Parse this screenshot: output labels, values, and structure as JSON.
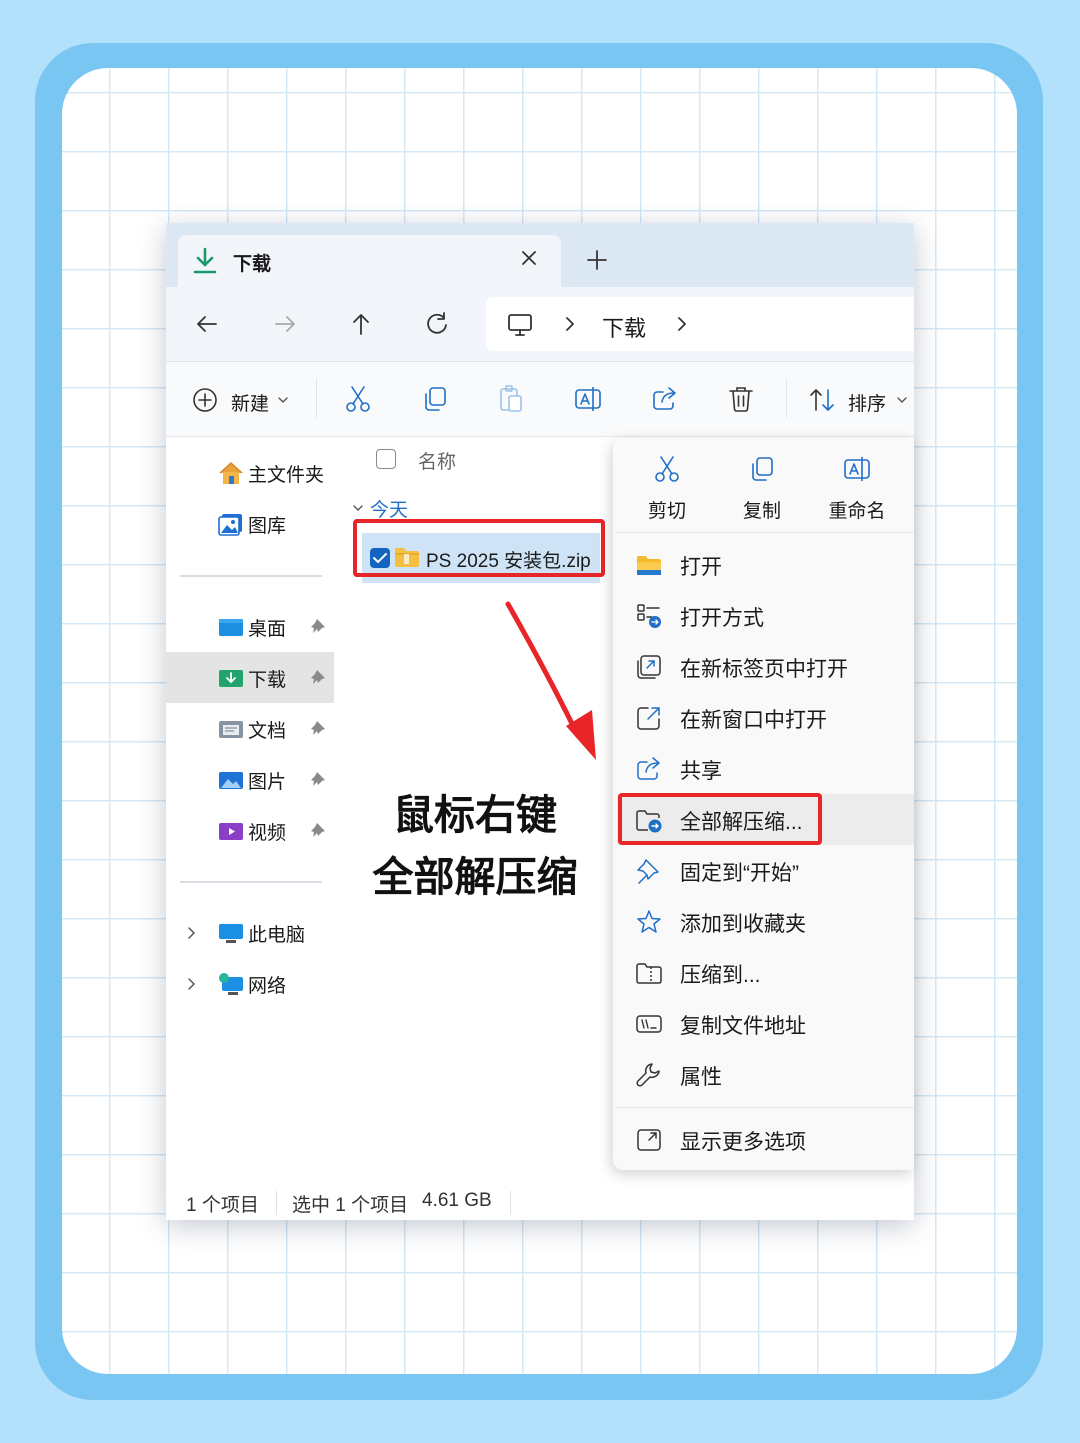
{
  "window": {
    "tab_title": "下载",
    "breadcrumb": "下载"
  },
  "toolbar": {
    "new_label": "新建",
    "sort_label": "排序"
  },
  "sidebar": {
    "items": [
      {
        "label": "主文件夹",
        "icon": "home-icon"
      },
      {
        "label": "图库",
        "icon": "gallery-icon"
      },
      {
        "label": "桌面",
        "icon": "desktop-folder-icon",
        "pinned": true
      },
      {
        "label": "下载",
        "icon": "downloads-folder-icon",
        "pinned": true,
        "selected": true
      },
      {
        "label": "文档",
        "icon": "documents-folder-icon",
        "pinned": true
      },
      {
        "label": "图片",
        "icon": "pictures-folder-icon",
        "pinned": true
      },
      {
        "label": "视频",
        "icon": "videos-folder-icon",
        "pinned": true
      },
      {
        "label": "此电脑",
        "icon": "this-pc-icon"
      },
      {
        "label": "网络",
        "icon": "network-icon"
      }
    ]
  },
  "content": {
    "column_name": "名称",
    "group_label": "今天",
    "file_name": "PS 2025 安装包.zip"
  },
  "status": {
    "item_count": "1 个项目",
    "selected": "选中 1 个项目",
    "size": "4.61 GB"
  },
  "context_menu": {
    "quick_actions": [
      {
        "label": "剪切",
        "icon": "scissors-icon"
      },
      {
        "label": "复制",
        "icon": "copy-icon"
      },
      {
        "label": "重命名",
        "icon": "rename-icon"
      }
    ],
    "items": [
      {
        "label": "打开",
        "icon": "folder-icon"
      },
      {
        "label": "打开方式",
        "icon": "open-with-icon"
      },
      {
        "label": "在新标签页中打开",
        "icon": "new-tab-icon"
      },
      {
        "label": "在新窗口中打开",
        "icon": "new-window-icon"
      },
      {
        "label": "共享",
        "icon": "share-icon"
      },
      {
        "label": "全部解压缩...",
        "icon": "extract-icon",
        "highlighted": true
      },
      {
        "label": "固定到“开始”",
        "icon": "pin-icon"
      },
      {
        "label": "添加到收藏夹",
        "icon": "star-icon"
      },
      {
        "label": "压缩到...",
        "icon": "compress-icon"
      },
      {
        "label": "复制文件地址",
        "icon": "copy-path-icon"
      },
      {
        "label": "属性",
        "icon": "wrench-icon"
      },
      {
        "label": "显示更多选项",
        "icon": "more-options-icon"
      }
    ]
  },
  "annotation": {
    "line1": "鼠标右键",
    "line2": "全部解压缩"
  },
  "colors": {
    "background": "#b3e0fb",
    "frame": "#7ac6f3",
    "highlight": "#e8262a",
    "accent": "#1f6fc7"
  }
}
